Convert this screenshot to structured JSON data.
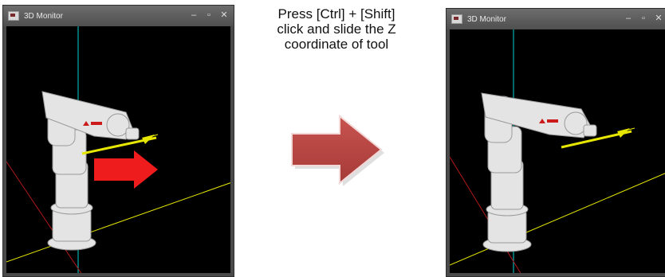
{
  "windows": {
    "left": {
      "title": "3D Monitor",
      "controls": {
        "minimize": "‒",
        "maximize": "▫",
        "close": "✕"
      }
    },
    "right": {
      "title": "3D Monitor",
      "controls": {
        "minimize": "‒",
        "maximize": "▫",
        "close": "✕"
      }
    }
  },
  "caption": {
    "line1": "Press [Ctrl] + [Shift]",
    "line2": "click and slide the Z",
    "line3": "coordinate of tool"
  },
  "colors": {
    "move_arrow": "#ee1c1c",
    "transition_arrow": "#c0504d",
    "tool_axis": "#e6e600",
    "z_axis": "#00d2d2",
    "x_axis": "#b01818",
    "grid_line": "#e6e600"
  }
}
